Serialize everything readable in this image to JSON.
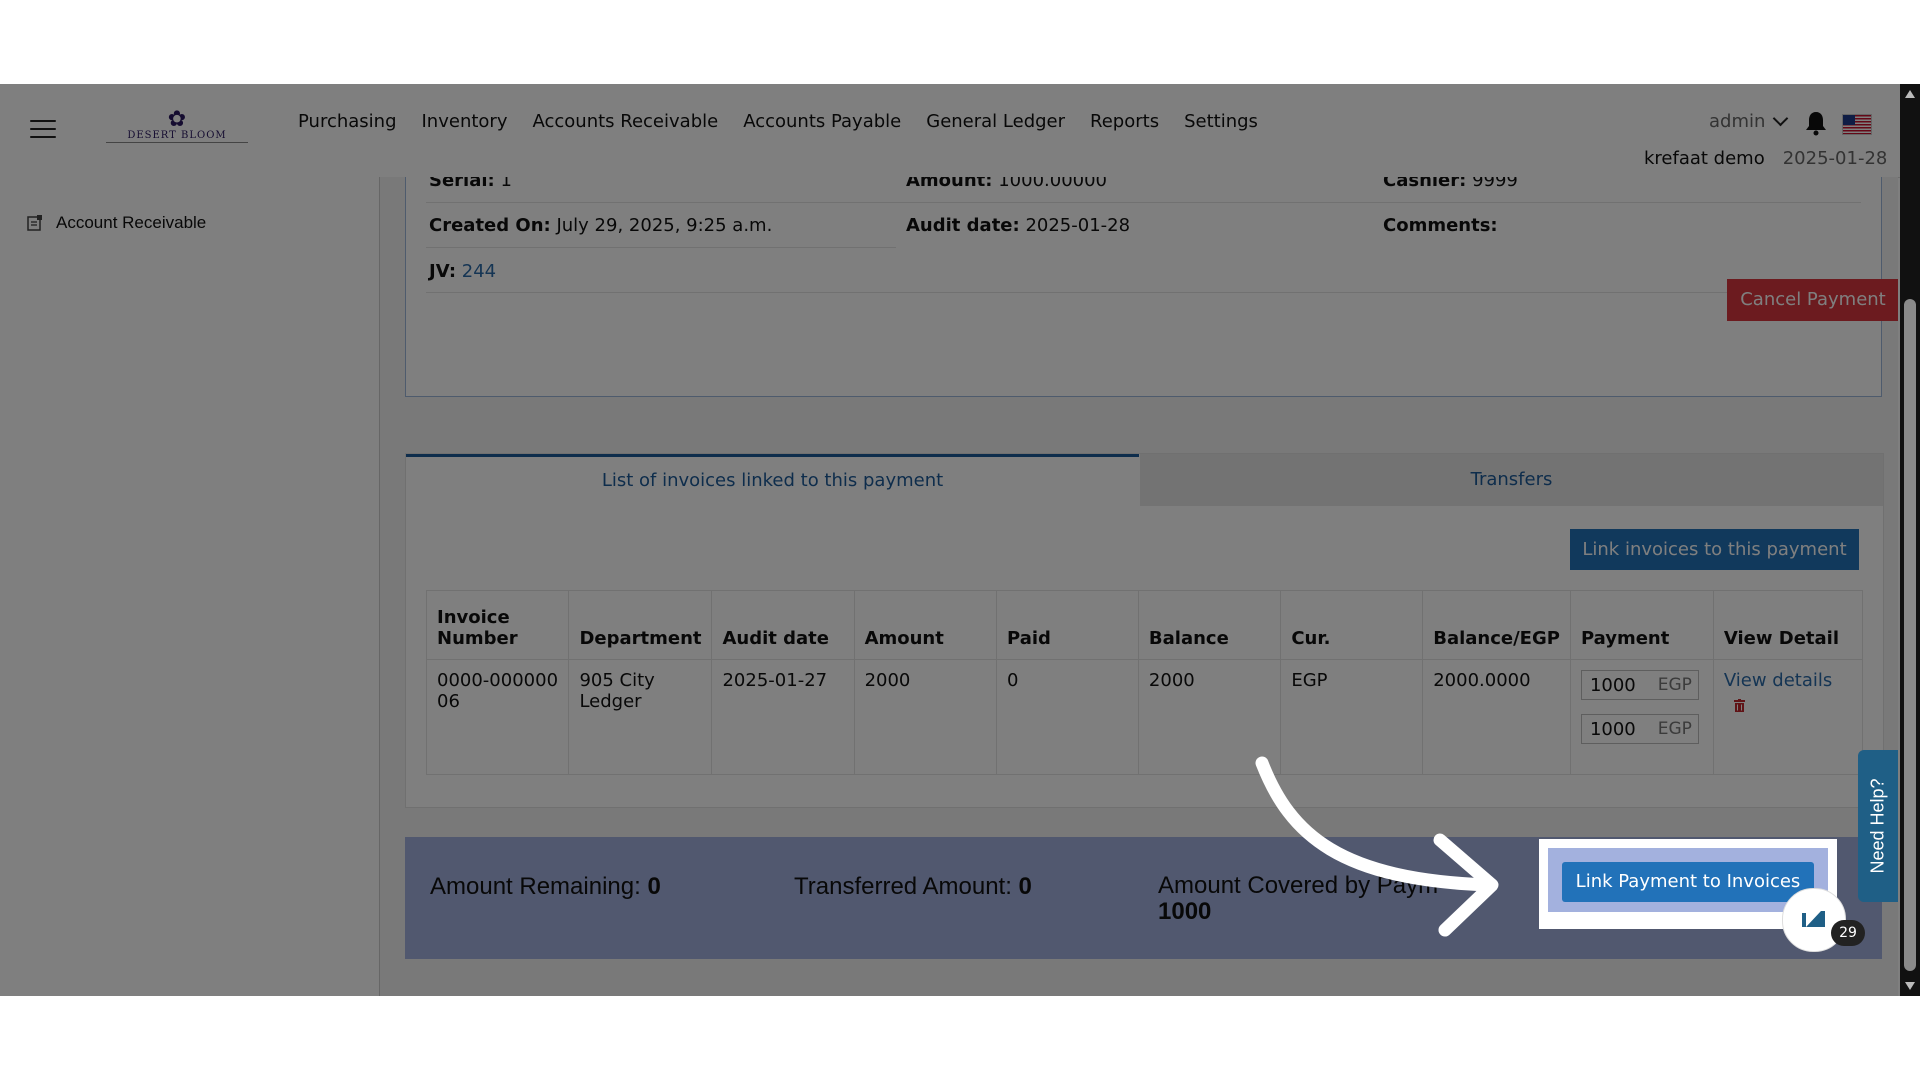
{
  "header": {
    "logo_text": "DESERT BLOOM",
    "nav": [
      "Purchasing",
      "Inventory",
      "Accounts Receivable",
      "Accounts Payable",
      "General Ledger",
      "Reports",
      "Settings"
    ],
    "user": "admin",
    "company": "krefaat demo",
    "date": "2025-01-28"
  },
  "sidebar": {
    "item": "Account Receivable"
  },
  "payment": {
    "serial_label": "Serial:",
    "serial_value": "1",
    "amount_label": "Amount:",
    "amount_value": "1000.00000",
    "cashier_label": "Cashier:",
    "cashier_value": "9999",
    "created_label": "Created On:",
    "created_value": "July 29, 2025, 9:25 a.m.",
    "audit_label": "Audit date:",
    "audit_value": "2025-01-28",
    "comments_label": "Comments:",
    "jv_label": "JV:",
    "jv_value": "244",
    "cancel_button": "Cancel Payment"
  },
  "tabs": {
    "tab1": "List of invoices linked to this payment",
    "tab2": "Transfers"
  },
  "link_invoices_button": "Link invoices to this payment",
  "table": {
    "headers": [
      "Invoice Number",
      "Department",
      "Audit date",
      "Amount",
      "Paid",
      "Balance",
      "Cur.",
      "Balance/EGP",
      "Payment",
      "View Detail"
    ],
    "row": {
      "invoice": "0000-00000006",
      "department": "905 City Ledger",
      "audit_date": "2025-01-27",
      "amount": "2000",
      "paid": "0",
      "balance": "2000",
      "cur": "EGP",
      "balance_egp": "2000.0000",
      "payment1": "1000",
      "payment1_cur": "EGP",
      "payment2": "1000",
      "payment2_cur": "EGP",
      "view": "View details"
    }
  },
  "summary": {
    "remaining_label": "Amount Remaining:",
    "remaining_value": "0",
    "transferred_label": "Transferred Amount:",
    "transferred_value": "0",
    "covered_label": "Amount Covered by Paym",
    "covered_value": "1000",
    "link_payment_button": "Link Payment to Invoices"
  },
  "widgets": {
    "need_help": "Need Help?",
    "badge_count": "29"
  },
  "colors": {
    "primary": "#2272b9",
    "danger": "#d9363e",
    "summary_bg": "#a3b1de",
    "help_bg": "#1f5f86"
  }
}
